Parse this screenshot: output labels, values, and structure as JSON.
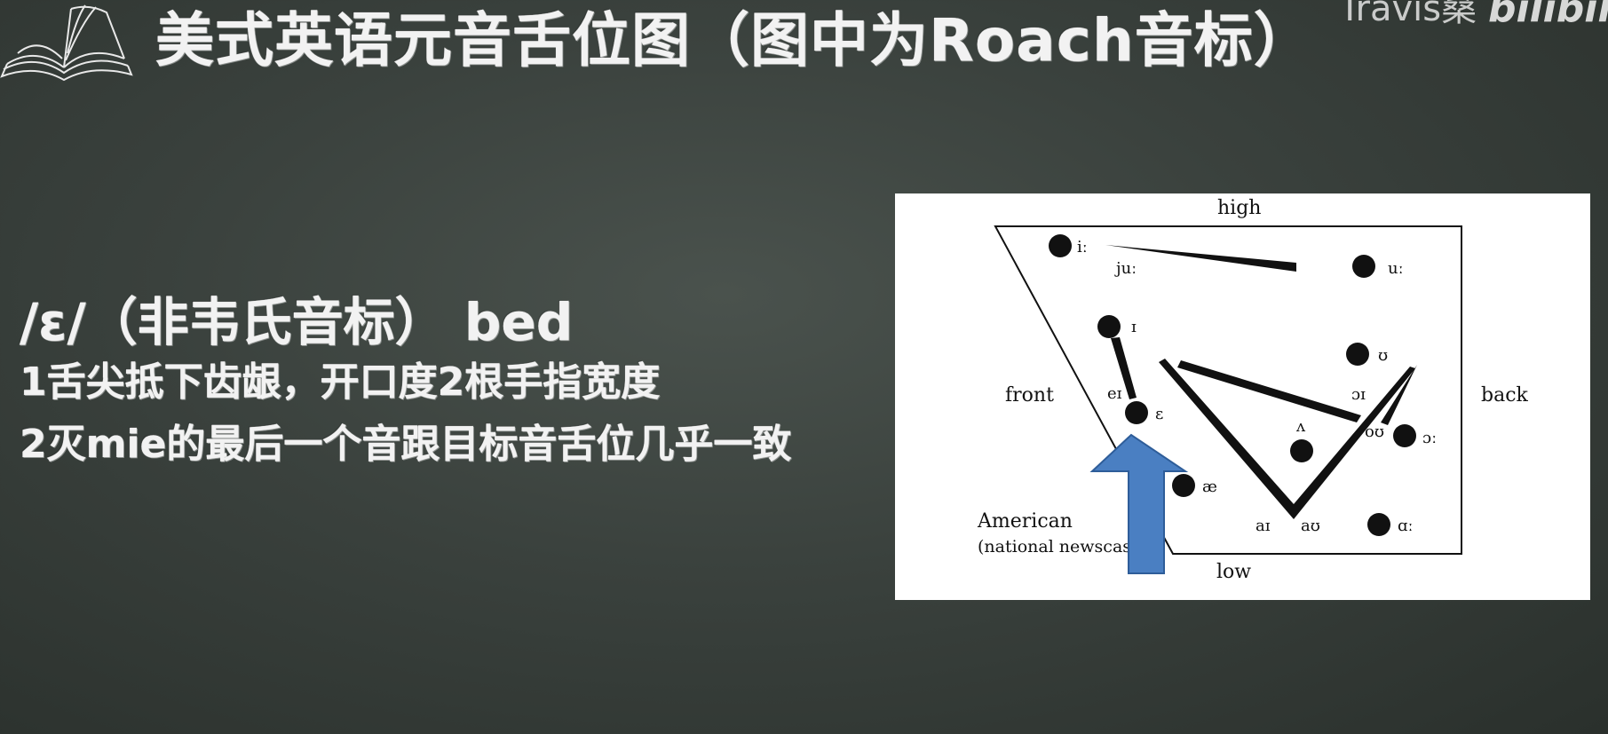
{
  "header": {
    "title": "美式英语元音舌位图（图中为Roach音标）",
    "watermark": "Travis桑",
    "platform_logo": "bilibili",
    "icon": "book-icon"
  },
  "lesson": {
    "phoneme_heading": "/ɛ/（非韦氏音标） bed",
    "points": [
      "1舌尖抵下齿龈，开口度2根手指宽度",
      "2灭mie的最后一个音跟目标音舌位几乎一致"
    ]
  },
  "diagram": {
    "axis_labels": {
      "high": "high",
      "low": "low",
      "front": "front",
      "back": "back"
    },
    "variety": {
      "line1": "American",
      "line2": "(national newscas"
    },
    "vowels": {
      "i_long": "iː",
      "ju_long": "juː",
      "u_long": "uː",
      "i_short": "ɪ",
      "u_short": "ʊ",
      "ei": "eɪ",
      "oi": "ɔɪ",
      "epsilon": "ɛ",
      "wedge": "ʌ",
      "ou": "oʊ",
      "open_o": "ɔː",
      "ae": "æ",
      "ai": "aɪ",
      "au": "aʊ",
      "a_long": "ɑː"
    },
    "highlight_arrow_color": "#4a7fc2"
  }
}
